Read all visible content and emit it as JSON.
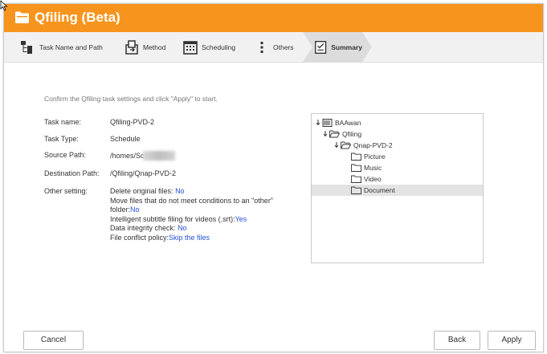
{
  "app": {
    "title": "Qfiling (Beta)"
  },
  "steps": [
    {
      "label": "Task Name and Path",
      "icon": "folder-tree-icon"
    },
    {
      "label": "Method",
      "icon": "move-files-icon"
    },
    {
      "label": "Scheduling",
      "icon": "calendar-icon"
    },
    {
      "label": "Others",
      "icon": "more-vertical-icon"
    },
    {
      "label": "Summary",
      "icon": "summary-icon"
    }
  ],
  "summary": {
    "intro": "Confirm the Qfiling task settings and click \"Apply\" to start.",
    "task_name_label": "Task name:",
    "task_name_value": "Qfiling-PVD-2",
    "task_type_label": "Task Type:",
    "task_type_value": "Schedule",
    "source_label": "Source Path:",
    "source_value": "/homes/Sc",
    "dest_label": "Destination Path:",
    "dest_value": "/Qfiling/Qnap-PVD-2",
    "other_label": "Other setting:",
    "other": {
      "delete_label": "Delete original files:",
      "delete_value": "No",
      "move_label_1": "Move files that do not meet conditions to an \"other\"",
      "move_label_2": "folder:",
      "move_value": "No",
      "subtitle_label": "Intelligent subtitle filing for videos (.srt):",
      "subtitle_value": "Yes",
      "integrity_label": "Data integrity check:",
      "integrity_value": "No",
      "conflict_label": "File conflict policy:",
      "conflict_value": "Skip the files"
    }
  },
  "tree": {
    "root": "BAAwan",
    "level1": "Qfiling",
    "level2": "Qnap-PVD-2",
    "children": [
      "Picture",
      "Music",
      "Video",
      "Document"
    ]
  },
  "buttons": {
    "cancel": "Cancel",
    "back": "Back",
    "apply": "Apply"
  },
  "colors": {
    "accent": "#f7941d",
    "link": "#2451d6"
  }
}
